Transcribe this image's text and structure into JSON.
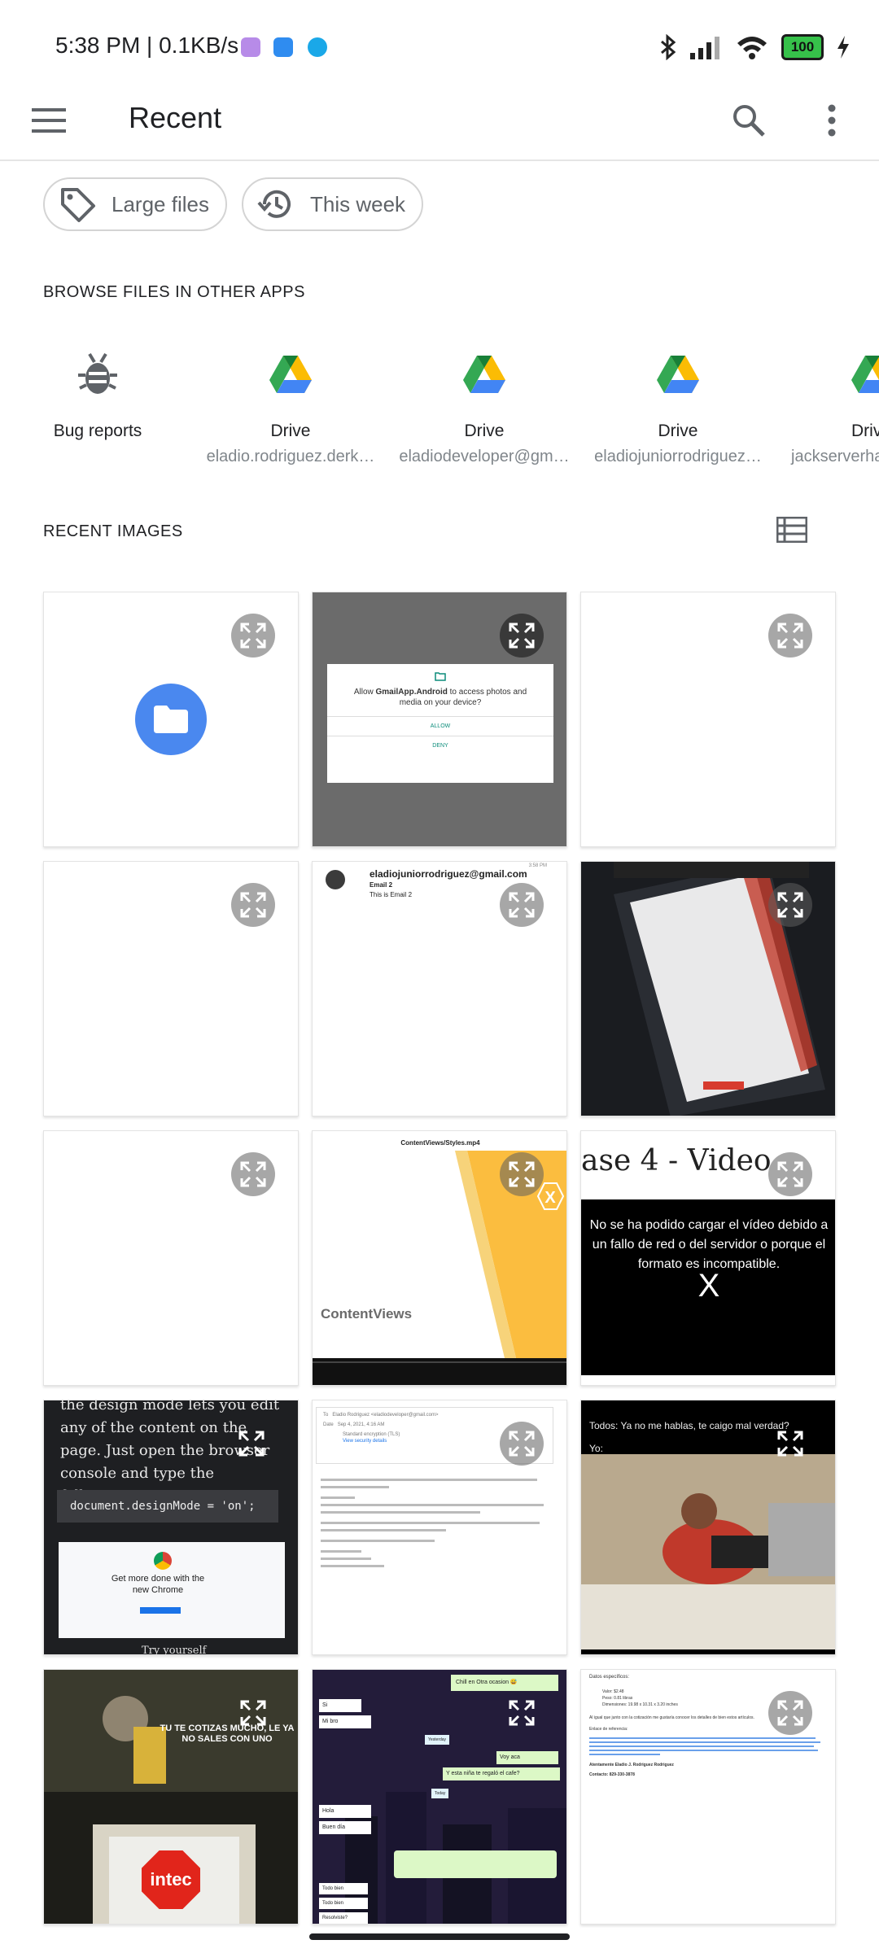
{
  "status_bar": {
    "time_speed": "5:38 PM | 0.1KB/s",
    "battery": "100"
  },
  "app_bar": {
    "title": "Recent",
    "menu_icon": "hamburger-menu-icon",
    "search_icon": "search-icon",
    "more_icon": "more-vert-icon"
  },
  "chips": [
    {
      "label": "Large files",
      "icon": "tag-icon"
    },
    {
      "label": "This week",
      "icon": "history-icon"
    }
  ],
  "browse": {
    "header": "BROWSE FILES IN OTHER APPS",
    "apps": [
      {
        "name": "Bug reports",
        "sub": "",
        "icon": "bug-icon"
      },
      {
        "name": "Drive",
        "sub": "eladio.rodriguez.derk…",
        "icon": "google-drive-icon"
      },
      {
        "name": "Drive",
        "sub": "eladiodeveloper@gm…",
        "icon": "google-drive-icon"
      },
      {
        "name": "Drive",
        "sub": "eladiojuniorrodriguez…",
        "icon": "google-drive-icon"
      },
      {
        "name": "Drive",
        "sub": "jackserverha",
        "icon": "google-drive-icon"
      }
    ]
  },
  "recent": {
    "header": "RECENT IMAGES",
    "view_icon": "list-view-icon"
  },
  "thumbs": {
    "perm_dialog": {
      "text_pre": "Allow ",
      "text_app": "GmailApp.Android",
      "text_post": " to access photos and media on your device?",
      "allow": "ALLOW",
      "deny": "DENY"
    },
    "email": {
      "sender": "eladiojuniorrodriguez@gmail.com",
      "subject": "Email 2",
      "body": "This is Email 2",
      "time": "3:58 PM"
    },
    "video": {
      "file": "ContentViews/Styles.mp4",
      "brand": "ContentViews"
    },
    "video_error": {
      "title": "ase 4 - Video",
      "message": "No se ha podido cargar el vídeo debido a un fallo de red o del servidor o porque el formato es incompatible.",
      "x": "X"
    },
    "article": {
      "text": "the design mode lets you edit any of the content on the page. Just open the browser console and type the following:",
      "code": "document.designMode = 'on';",
      "promo": "Get more done with the new Chrome",
      "footer": "Try yourself"
    },
    "mail_detail": {
      "to_label": "To",
      "to_value": "Eladio Rodriguez <eladiodeveloper@gmail.com>",
      "date_label": "Date",
      "date_value": "Sep 4, 2021, 4:16 AM",
      "security": "Standard encryption (TLS)",
      "link": "View security details"
    },
    "meme": {
      "caption1": "Todos: Ya no me hablas, te caigo mal verdad?",
      "caption2": "Yo:"
    },
    "meme2": {
      "caption": "TU TE COTIZAS MUCHO, LE YA NO SALES CON UNO",
      "logo": "intec"
    },
    "chat": {
      "top_msg": "Chill en Otra ocasion 😅",
      "msgs": [
        "Si",
        "Mi bro",
        "Yesterday",
        "Voy aca",
        "Y esta niña te regaló el cafe?",
        "Today",
        "Hola",
        "Buen día"
      ],
      "bottom": [
        "Todo bien",
        "Todo bien",
        "Resolviste?"
      ]
    },
    "doc": {
      "title": "Datos específicos:",
      "bullets": [
        "Valor: $2.48",
        "Peso: 0.81 libras",
        "Dimensiones: 19.98 x 10.31 x 3.20 inches"
      ],
      "line": "Al igual que junto con la cotización me gustaría conocer los detalles de bien estos artículos.",
      "ref": "Enlace de referencia:",
      "sign": "Atentamente Eladio J. Rodriguez Rodriguez",
      "contact": "Contacto: 829-330-3878"
    }
  }
}
